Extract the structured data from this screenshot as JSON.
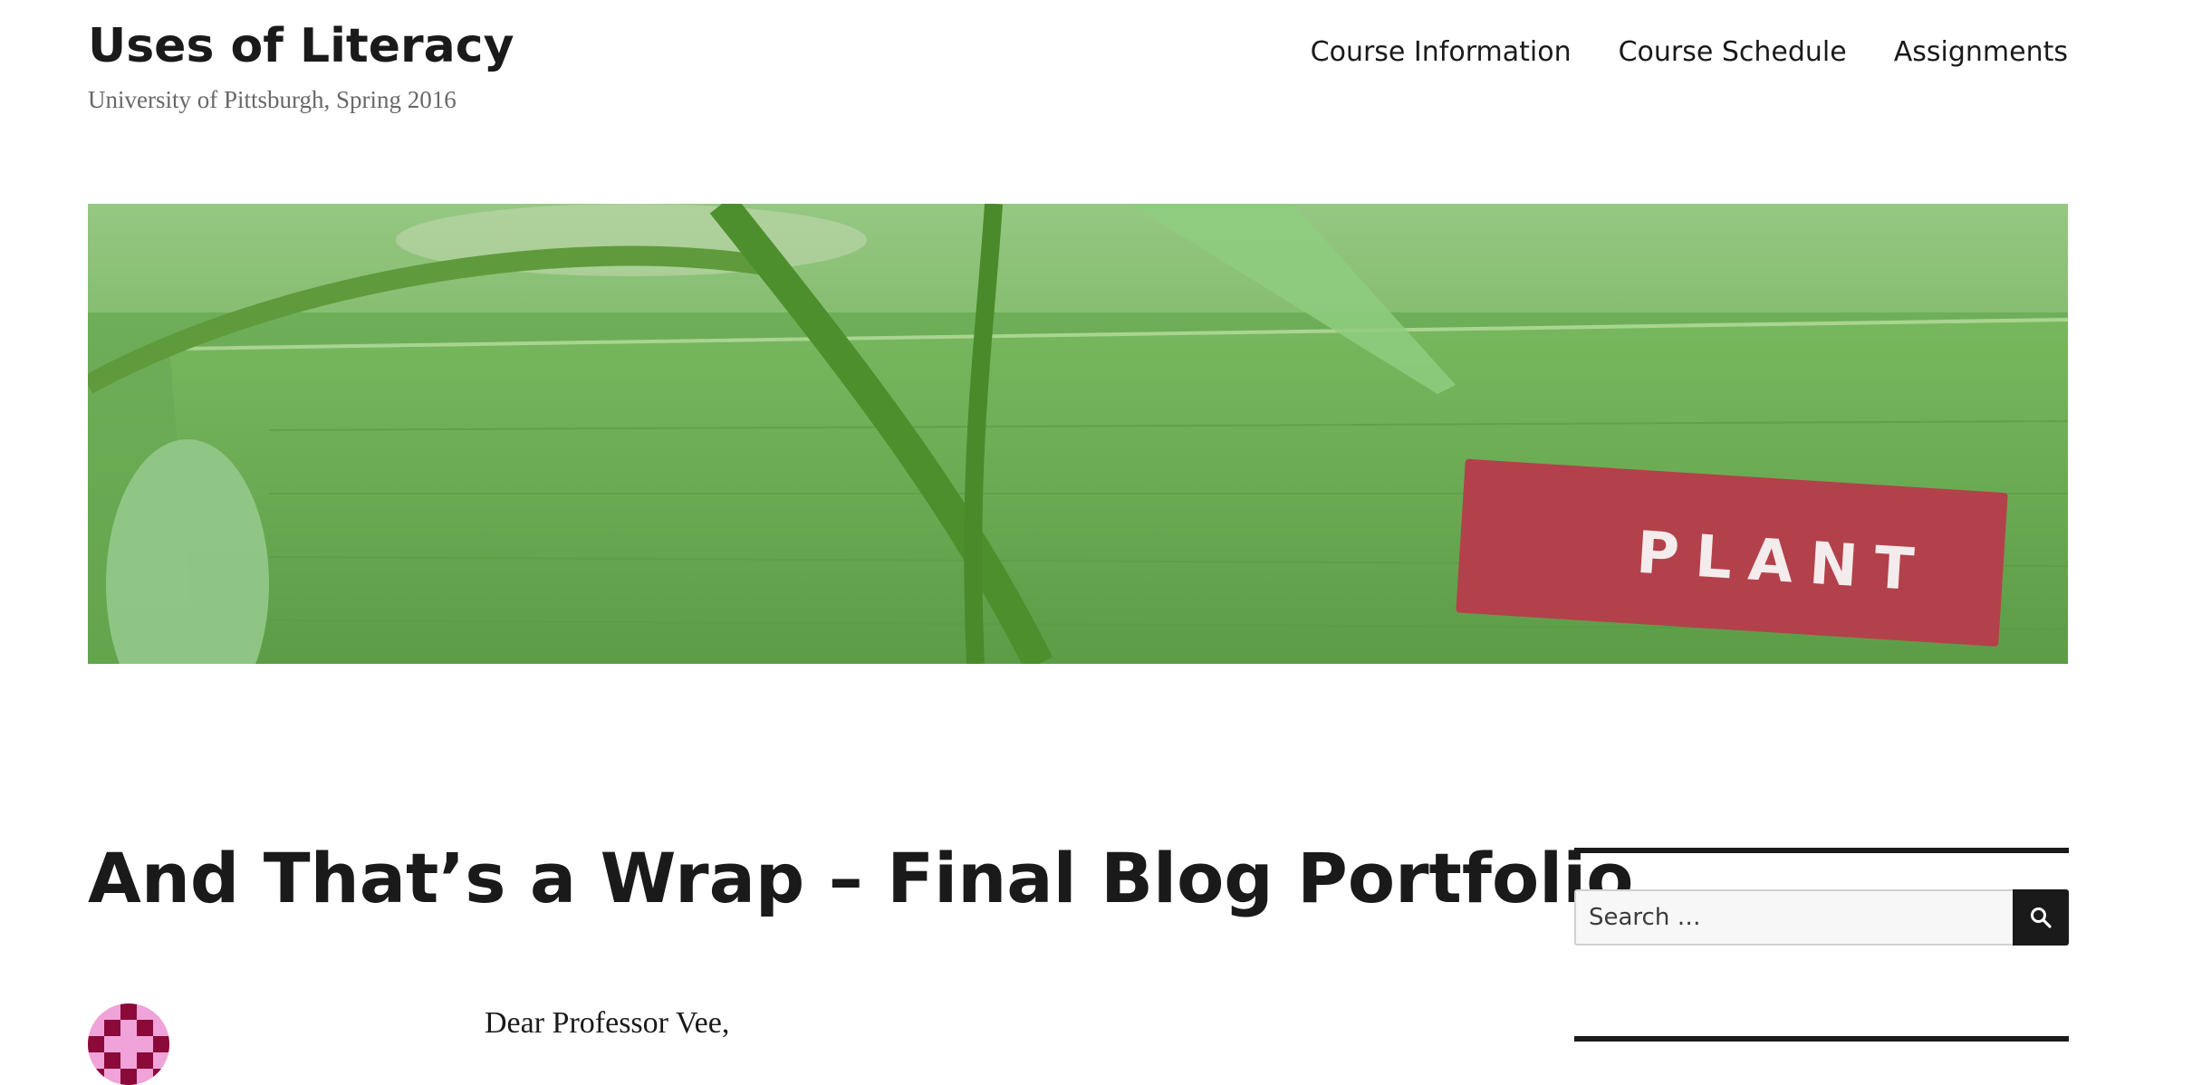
{
  "site": {
    "title": "Uses of Literacy",
    "description": "University of Pittsburgh, Spring 2016"
  },
  "nav": {
    "items": [
      {
        "label": "Course Information"
      },
      {
        "label": "Course Schedule"
      },
      {
        "label": "Assignments"
      }
    ]
  },
  "header_image": {
    "label_text": "PLANT",
    "colors": {
      "leaf": "#6aac52",
      "label": "#b3414b"
    }
  },
  "post": {
    "title": "And That’s a Wrap – Final Blog Portfolio",
    "first_line": "Dear Professor Vee,"
  },
  "sidebar": {
    "search": {
      "placeholder": "Search …",
      "button_icon": "search-icon"
    }
  },
  "colors": {
    "text": "#1a1a1a",
    "muted": "#686868",
    "avatar_bg": "#f0a3d9",
    "avatar_fg": "#8b0a3a"
  }
}
